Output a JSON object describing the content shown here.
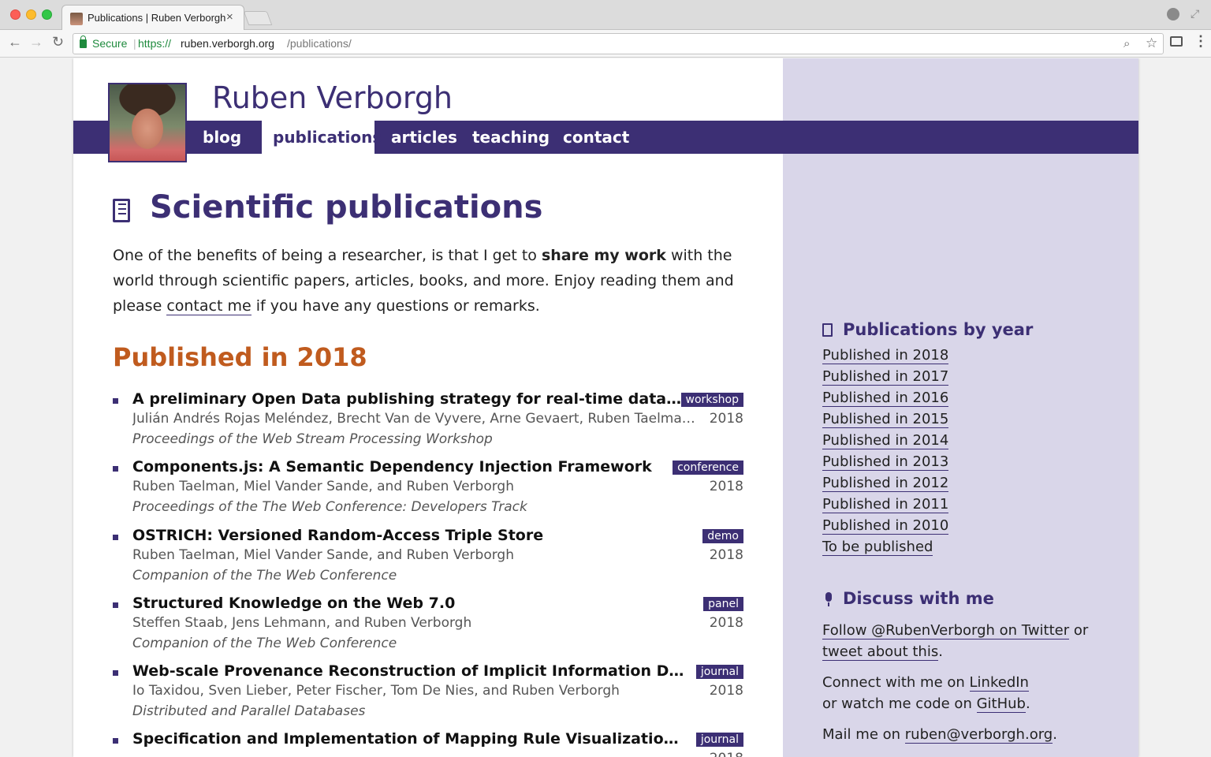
{
  "browser": {
    "tab_title": "Publications | Ruben Verborgh",
    "secure_label": "Secure",
    "separator": "|",
    "url_scheme": "https://",
    "url_host": "ruben.verborgh.org",
    "url_path": "/publications/"
  },
  "site": {
    "title": "Ruben Verborgh",
    "nav": [
      "blog",
      "publications",
      "articles",
      "teaching",
      "contact"
    ],
    "active_nav": "publications"
  },
  "main": {
    "title": "Scientific publications",
    "intro_part1": "One of the benefits of being a researcher, is that I get to ",
    "intro_bold": "share my work",
    "intro_part2": " with the world through scientific papers, articles, books, and more. Enjoy reading them and please ",
    "intro_link": "contact me",
    "intro_part3": " if you have any questions or remarks.",
    "year_heading": "Published in 2018",
    "publications": [
      {
        "title": "A preliminary Open Data publishing strategy for real-time data in Flanders",
        "tag": "workshop",
        "authors": "Julián Andrés Rojas Meléndez, Brecht Van de Vyvere, Arne Gevaert, Ruben Taelman, Pieter Colpaert, and Ruben Verborgh",
        "year": "2018",
        "venue": "Proceedings of the Web Stream Processing Workshop"
      },
      {
        "title": "Components.js: A Semantic Dependency Injection Framework",
        "tag": "conference",
        "authors": "Ruben Taelman, Miel Vander Sande, and Ruben Verborgh",
        "year": "2018",
        "venue": "Proceedings of the The Web Conference: Developers Track"
      },
      {
        "title": "OSTRICH: Versioned Random-Access Triple Store",
        "tag": "demo",
        "authors": "Ruben Taelman, Miel Vander Sande, and Ruben Verborgh",
        "year": "2018",
        "venue": "Companion of the The Web Conference"
      },
      {
        "title": "Structured Knowledge on the Web 7.0",
        "tag": "panel",
        "authors": "Steffen Staab, Jens Lehmann, and Ruben Verborgh",
        "year": "2018",
        "venue": "Companion of the The Web Conference"
      },
      {
        "title": "Web-scale Provenance Reconstruction of Implicit Information Diffusion on Social Media",
        "tag": "journal",
        "authors": "Io Taxidou, Sven Lieber, Peter Fischer, Tom De Nies, and Ruben Verborgh",
        "year": "2018",
        "venue": "Distributed and Parallel Databases"
      },
      {
        "title": "Specification and Implementation of Mapping Rule Visualization and Editing",
        "tag": "journal",
        "authors": "",
        "year": "2018",
        "venue": ""
      }
    ]
  },
  "sidebar": {
    "pubs_heading": "Publications by year",
    "year_links": [
      "Published in 2018",
      "Published in 2017",
      "Published in 2016",
      "Published in 2015",
      "Published in 2014",
      "Published in 2013",
      "Published in 2012",
      "Published in 2011",
      "Published in 2010",
      "To be published"
    ],
    "discuss_heading": "Discuss with me",
    "twitter_link": "Follow @RubenVerborgh on Twitter",
    "twitter_or": " or ",
    "tweet_link": "tweet about this",
    "tweet_end": ".",
    "connect_text": "Connect with me on ",
    "linkedin_link": "LinkedIn",
    "watch_text": "or watch me code on ",
    "github_link": "GitHub",
    "github_end": ".",
    "mail_text": "Mail me on ",
    "mail_link": "ruben@verborgh.org",
    "mail_end": "."
  }
}
